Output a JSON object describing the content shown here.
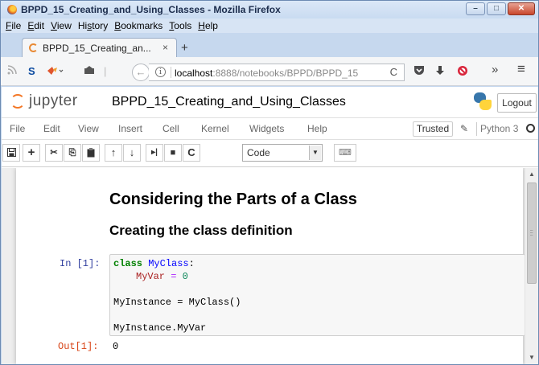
{
  "window": {
    "title": "BPPD_15_Creating_and_Using_Classes - Mozilla Firefox",
    "controls": {
      "minimize": "–",
      "maximize": "□",
      "close": "✕"
    }
  },
  "browser_menu": [
    {
      "label": "File",
      "accel": "F",
      "rest": "ile"
    },
    {
      "label": "Edit",
      "accel": "E",
      "rest": "dit"
    },
    {
      "label": "View",
      "accel": "V",
      "rest": "iew"
    },
    {
      "label": "History",
      "accel": "",
      "pre": "Hi",
      "accel2": "s",
      "rest2": "tory"
    },
    {
      "label": "Bookmarks",
      "accel": "B",
      "rest": "ookmarks"
    },
    {
      "label": "Tools",
      "accel": "T",
      "rest": "ools"
    },
    {
      "label": "Help",
      "accel": "H",
      "rest": "elp"
    }
  ],
  "tab": {
    "title": "BPPD_15_Creating_an...",
    "close": "×"
  },
  "new_tab": "+",
  "navbar": {
    "url_host": "localhost",
    "url_rest": ":8888/notebooks/BPPD/BPPD_15",
    "info": "i",
    "reload": "C",
    "icons": {
      "rss": "rss-icon",
      "skype": "skype-icon",
      "addon": "addon-icon",
      "inbox": "inbox-icon",
      "back": "back-arrow-icon",
      "pocket": "pocket-icon",
      "download": "download-icon",
      "block": "block-icon",
      "overflow": "overflow-icon",
      "menu": "hamburger-menu-icon"
    },
    "overflow_label": "»",
    "menu_label": "≡"
  },
  "jupyter": {
    "logo_text": "jupyter",
    "notebook_name": "BPPD_15_Creating_and_Using_Classes",
    "logout": "Logout",
    "menu": [
      "File",
      "Edit",
      "View",
      "Insert",
      "Cell",
      "Kernel",
      "Widgets",
      "Help"
    ],
    "trusted": "Trusted",
    "kernel": "Python 3",
    "cell_type": "Code",
    "toolbar": {
      "save": "🖫",
      "insert": "+",
      "cut": "✂",
      "copy": "⎘",
      "paste": "📋",
      "move_up": "↑",
      "move_down": "↓",
      "run": "▸|",
      "stop": "■",
      "restart": "C",
      "keyboard": "⌨"
    }
  },
  "notebook": {
    "heading1": "Considering the Parts of a Class",
    "heading2": "Creating the class definition",
    "in_prompt": "In [1]:",
    "code": {
      "line1_kw": "class",
      "line1_name": "MyClass",
      "line1_colon": ":",
      "line2_var": "MyVar",
      "line2_eq": " = ",
      "line2_num": "0",
      "line3": "MyInstance = MyClass()",
      "line4": "MyInstance.MyVar"
    },
    "out_prompt": "Out[1]:",
    "out_value": "0"
  }
}
